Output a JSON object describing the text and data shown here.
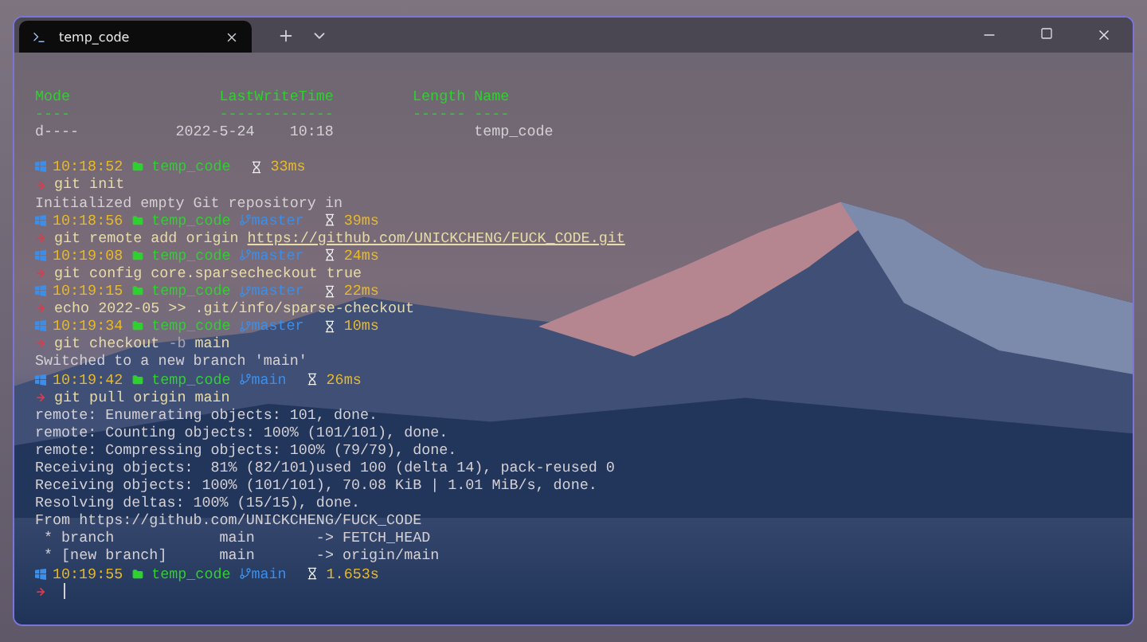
{
  "window": {
    "tabs": [
      {
        "title": "temp_code",
        "selected": true
      }
    ]
  },
  "listing": {
    "columns": [
      "Mode",
      "LastWriteTime",
      "Length",
      "Name"
    ],
    "underlines": [
      "----",
      "-------------",
      "------",
      "----"
    ],
    "rows": [
      [
        "d----",
        "2022-5-24    10:18",
        "",
        "temp_code"
      ]
    ]
  },
  "lines": [
    {
      "kind": "prompt",
      "time": "10:18:52",
      "dir": "temp_code",
      "duration": "33ms"
    },
    {
      "kind": "command",
      "parts": [
        {
          "kind": "plain",
          "text": "git init"
        }
      ]
    },
    {
      "kind": "output",
      "text": "Initialized empty Git repository in"
    },
    {
      "kind": "prompt",
      "time": "10:18:56",
      "dir": "temp_code",
      "branch": "master",
      "duration": "39ms"
    },
    {
      "kind": "command",
      "parts": [
        {
          "kind": "plain",
          "text": "git remote add origin "
        },
        {
          "kind": "link",
          "text": "https://github.com/UNICKCHENG/FUCK_CODE.git"
        }
      ]
    },
    {
      "kind": "prompt",
      "time": "10:19:08",
      "dir": "temp_code",
      "branch": "master",
      "duration": "24ms"
    },
    {
      "kind": "command",
      "parts": [
        {
          "kind": "plain",
          "text": "git config core.sparsecheckout true"
        }
      ]
    },
    {
      "kind": "prompt",
      "time": "10:19:15",
      "dir": "temp_code",
      "branch": "master",
      "duration": "22ms"
    },
    {
      "kind": "command",
      "parts": [
        {
          "kind": "plain",
          "text": "echo 2022-05 >> .git/info/sparse-checkout"
        }
      ]
    },
    {
      "kind": "prompt",
      "time": "10:19:34",
      "dir": "temp_code",
      "branch": "master",
      "duration": "10ms"
    },
    {
      "kind": "command",
      "parts": [
        {
          "kind": "plain",
          "text": "git checkout "
        },
        {
          "kind": "flag",
          "text": "-b"
        },
        {
          "kind": "plain",
          "text": " main"
        }
      ]
    },
    {
      "kind": "output",
      "text": "Switched to a new branch 'main'"
    },
    {
      "kind": "prompt",
      "time": "10:19:42",
      "dir": "temp_code",
      "branch": "main",
      "duration": "26ms"
    },
    {
      "kind": "command",
      "parts": [
        {
          "kind": "plain",
          "text": "git pull origin main"
        }
      ]
    },
    {
      "kind": "output",
      "text": "remote: Enumerating objects: 101, done."
    },
    {
      "kind": "output",
      "text": "remote: Counting objects: 100% (101/101), done."
    },
    {
      "kind": "output",
      "text": "remote: Compressing objects: 100% (79/79), done."
    },
    {
      "kind": "output",
      "text": "Receiving objects:  81% (82/101)used 100 (delta 14), pack-reused 0"
    },
    {
      "kind": "output",
      "text": "Receiving objects: 100% (101/101), 70.08 KiB | 1.01 MiB/s, done."
    },
    {
      "kind": "output",
      "text": "Resolving deltas: 100% (15/15), done."
    },
    {
      "kind": "output",
      "text": "From https://github.com/UNICKCHENG/FUCK_CODE"
    },
    {
      "kind": "output",
      "text": " * branch            main       -> FETCH_HEAD"
    },
    {
      "kind": "output",
      "text": " * [new branch]      main       -> origin/main"
    },
    {
      "kind": "prompt",
      "time": "10:19:55",
      "dir": "temp_code",
      "branch": "main",
      "duration": "1.653s"
    },
    {
      "kind": "input"
    }
  ]
}
